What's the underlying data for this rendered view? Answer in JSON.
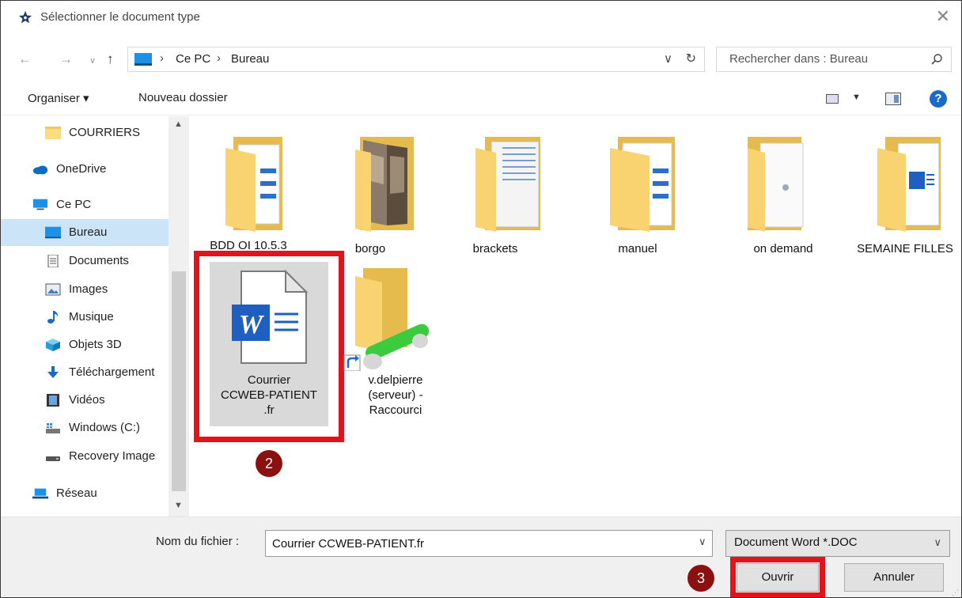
{
  "window": {
    "title": "Sélectionner le document type"
  },
  "address": {
    "crumbs": [
      "Ce PC",
      "Bureau"
    ],
    "search_placeholder": "Rechercher dans : Bureau"
  },
  "toolbar": {
    "organise_label": "Organiser ▾",
    "new_folder_label": "Nouveau dossier"
  },
  "sidebar": {
    "items": [
      {
        "label": "COURRIERS",
        "icon": "folder-icon"
      },
      {
        "label": "OneDrive",
        "icon": "cloud-icon"
      },
      {
        "label": "Ce PC",
        "icon": "computer-icon"
      },
      {
        "label": "Bureau",
        "icon": "desktop-icon",
        "selected": true
      },
      {
        "label": "Documents",
        "icon": "document-icon"
      },
      {
        "label": "Images",
        "icon": "image-icon"
      },
      {
        "label": "Musique",
        "icon": "music-icon"
      },
      {
        "label": "Objets 3D",
        "icon": "cube-icon"
      },
      {
        "label": "Téléchargement",
        "icon": "download-icon"
      },
      {
        "label": "Vidéos",
        "icon": "video-icon"
      },
      {
        "label": "Windows (C:)",
        "icon": "drive-icon"
      },
      {
        "label": "Recovery Image",
        "icon": "drive-icon"
      },
      {
        "label": "Réseau",
        "icon": "network-icon"
      }
    ]
  },
  "files": [
    {
      "label": "BDD OI 10.5.3",
      "type": "folder"
    },
    {
      "label": "borgo",
      "type": "folder-photos"
    },
    {
      "label": "brackets",
      "type": "folder-docs"
    },
    {
      "label": "manuel",
      "type": "folder"
    },
    {
      "label": "on demand",
      "type": "folder-page"
    },
    {
      "label": "SEMAINE FILLES",
      "type": "folder-word"
    },
    {
      "label_lines": [
        "Courrier",
        "CCWEB-PATIENT",
        ".fr"
      ],
      "type": "word-document",
      "selected": true
    },
    {
      "label_lines": [
        "v.delpierre",
        "(serveur) -",
        "Raccourci"
      ],
      "type": "network-shortcut"
    }
  ],
  "steps": {
    "file_step": "2",
    "open_step": "3"
  },
  "bottom": {
    "filename_label": "Nom du fichier :",
    "filename_value": "Courrier CCWEB-PATIENT.fr",
    "filetype": "Document Word *.DOC",
    "open_label": "Ouvrir",
    "cancel_label": "Annuler"
  },
  "colors": {
    "highlight_red": "#e0141a",
    "badge": "#8b1111",
    "selection": "#cce4f7",
    "word_blue": "#1f5fbf"
  }
}
